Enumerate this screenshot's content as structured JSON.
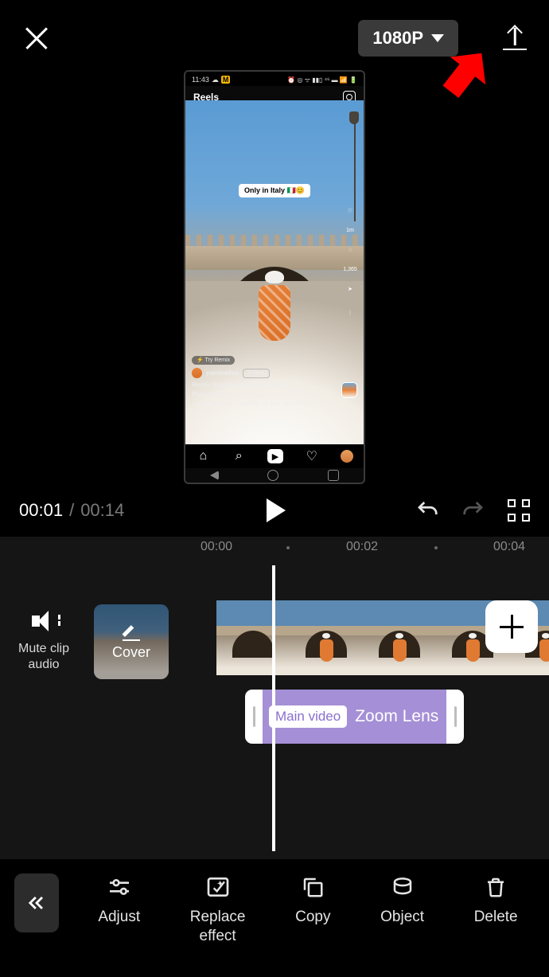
{
  "topbar": {
    "resolution": "1080P"
  },
  "preview": {
    "status_time": "11:43",
    "reels_label": "Reels",
    "caption_pill": "Only in Italy 🇮🇹😊",
    "try_remix": "⚡ Try Remix",
    "username": "yaminelisa",
    "follow_label": "Follow",
    "remix_credit": "Remix Together with sicilyroadtrip",
    "desc_line": "Pheww that was too close ...",
    "audio_line": "♪ sickickmusic • running up that hill sickmix",
    "likes": "1m",
    "comments": "1,365"
  },
  "playback": {
    "current": "00:01",
    "sep": "/",
    "duration": "00:14"
  },
  "timeline": {
    "mute_label_l1": "Mute clip",
    "mute_label_l2": "audio",
    "cover_label": "Cover",
    "ticks": [
      "00:00",
      "00:02",
      "00:04"
    ],
    "effect_tag": "Main video",
    "effect_name": "Zoom Lens"
  },
  "toolbar": {
    "adjust": "Adjust",
    "replace_l1": "Replace",
    "replace_l2": "effect",
    "copy": "Copy",
    "object": "Object",
    "delete": "Delete"
  }
}
